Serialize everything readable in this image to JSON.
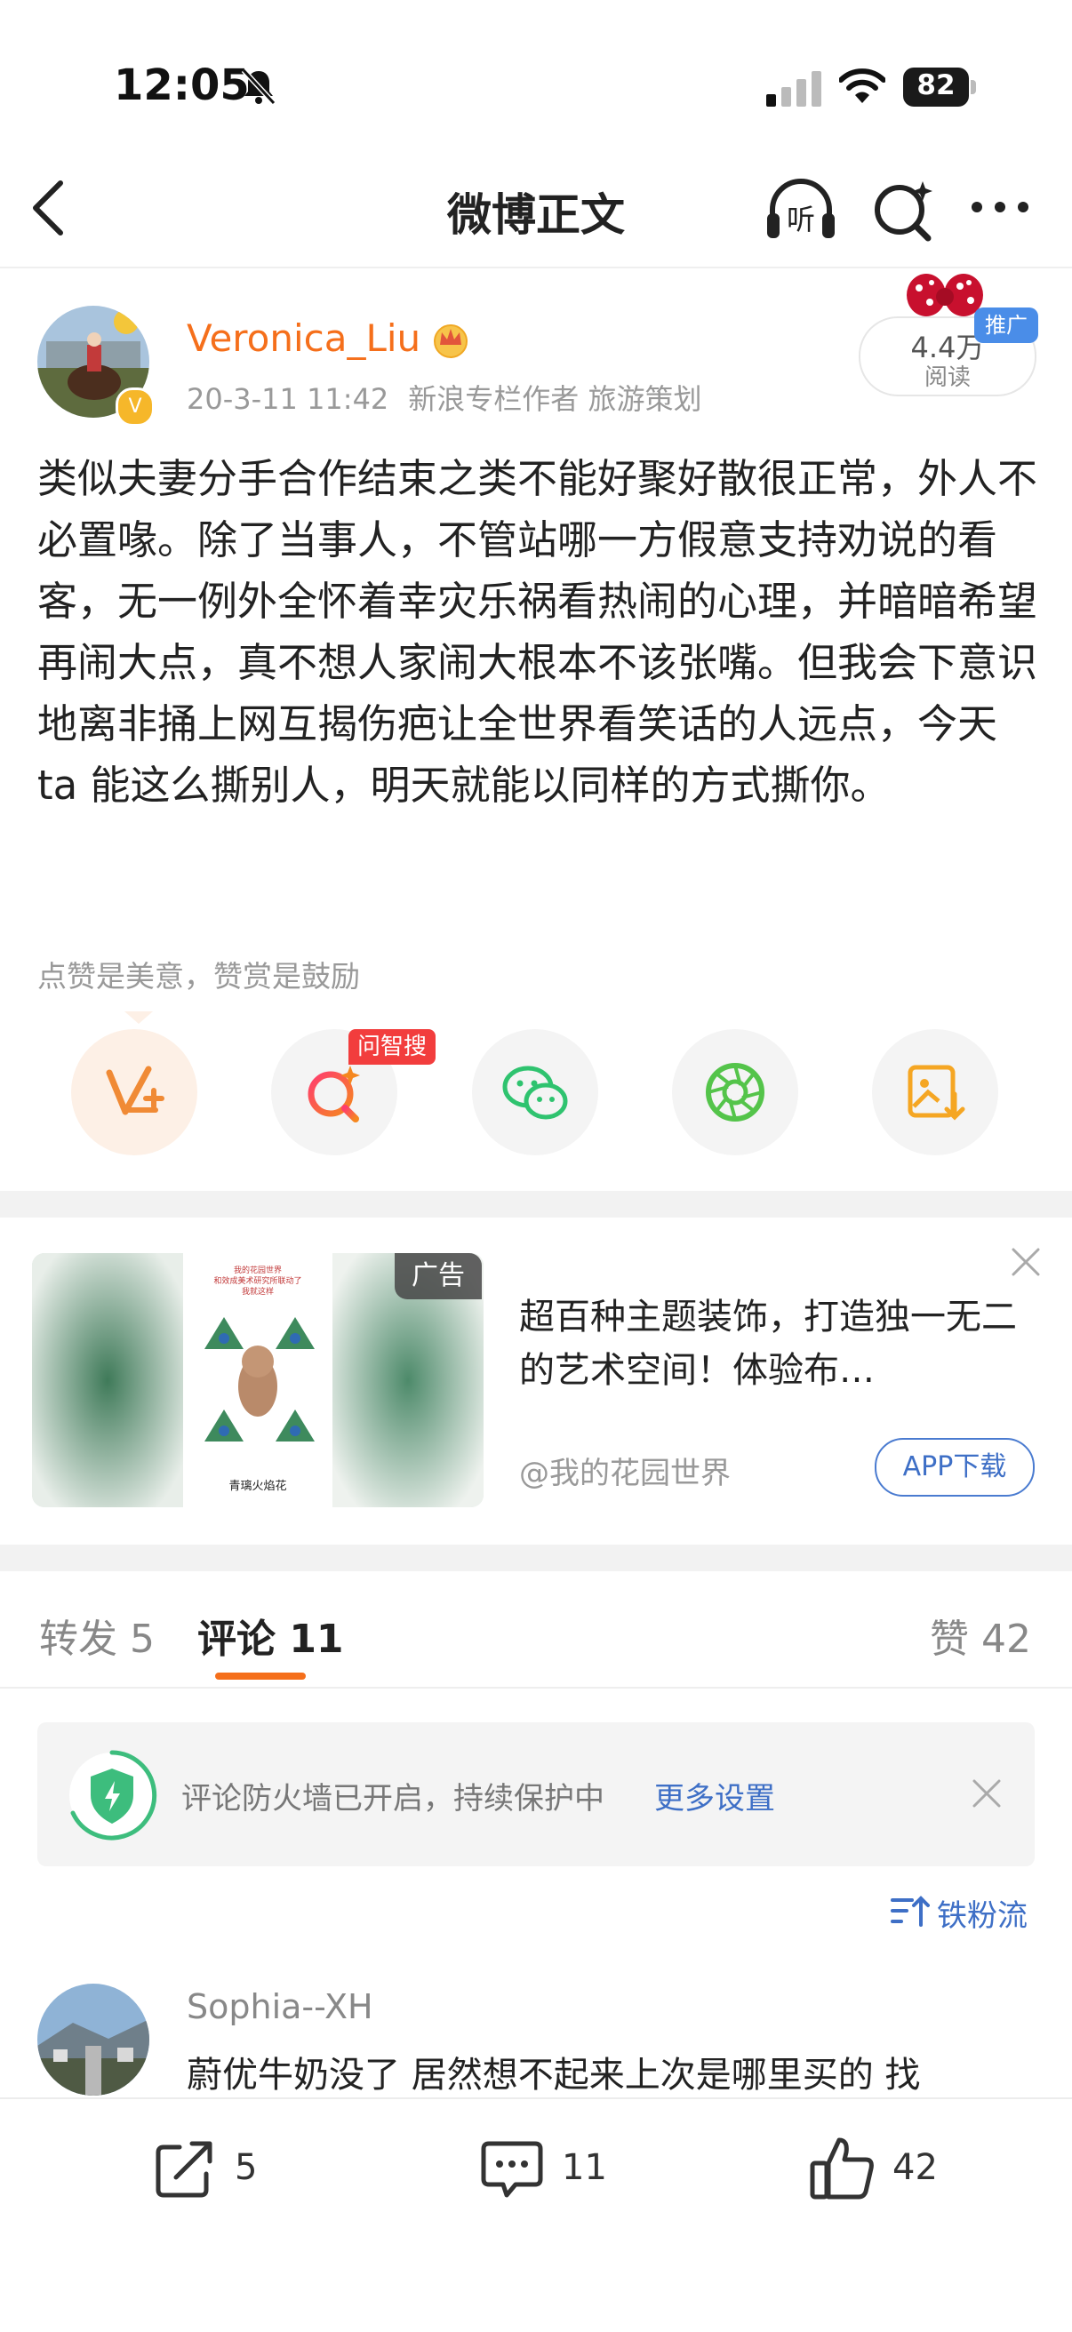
{
  "status_bar": {
    "time": "12:05",
    "battery": "82"
  },
  "nav": {
    "title": "微博正文"
  },
  "post": {
    "author": "Veronica_Liu",
    "date": "20-3-11 11:42",
    "author_desc": "新浪专栏作者 旅游策划",
    "reads": "4.4万",
    "reads_label": "阅读",
    "promo_tag": "推广",
    "text": "类似夫妻分手合作结束之类不能好聚好散很正常，外人不必置喙。除了当事人，不管站哪一方假意支持劝说的看客，无一例外全怀着幸灾乐祸看热闹的心理，并暗暗希望再闹大点，真不想人家闹大根本不该张嘴。但我会下意识地离非捅上网互揭伤疤让全世界看笑话的人远点，今天 ta 能这么撕别人，明天就能以同样的方式撕你。",
    "like_hint": "点赞是美意，赞赏是鼓励",
    "zhisou_badge": "问智搜"
  },
  "ad": {
    "tag": "广告",
    "text": "超百种主题装饰，打造独一无二的艺术空间！体验布…",
    "source": "@我的花园世界",
    "button": "APP下载",
    "image_caption_top": "我的花园世界 和效成美术研究所联动了 我就这样",
    "image_caption_bottom": "青璃火焰花"
  },
  "tabs": {
    "repost": "转发 5",
    "comments": "评论 11",
    "likes": "赞 42"
  },
  "firewall": {
    "text": "评论防火墙已开启，持续保护中",
    "link": "更多设置"
  },
  "sort": {
    "label": "铁粉流"
  },
  "comment": {
    "user": "Sophia--XH",
    "text": "蔚优牛奶没了 居然想不起来上次是哪里买的  找"
  },
  "bottom_bar": {
    "reposts": "5",
    "comments": "11",
    "likes": "42"
  },
  "colors": {
    "accent": "#f56f1b",
    "link": "#3e6fc6",
    "promo": "#4a8de8",
    "badge_red": "#f23d3d"
  }
}
